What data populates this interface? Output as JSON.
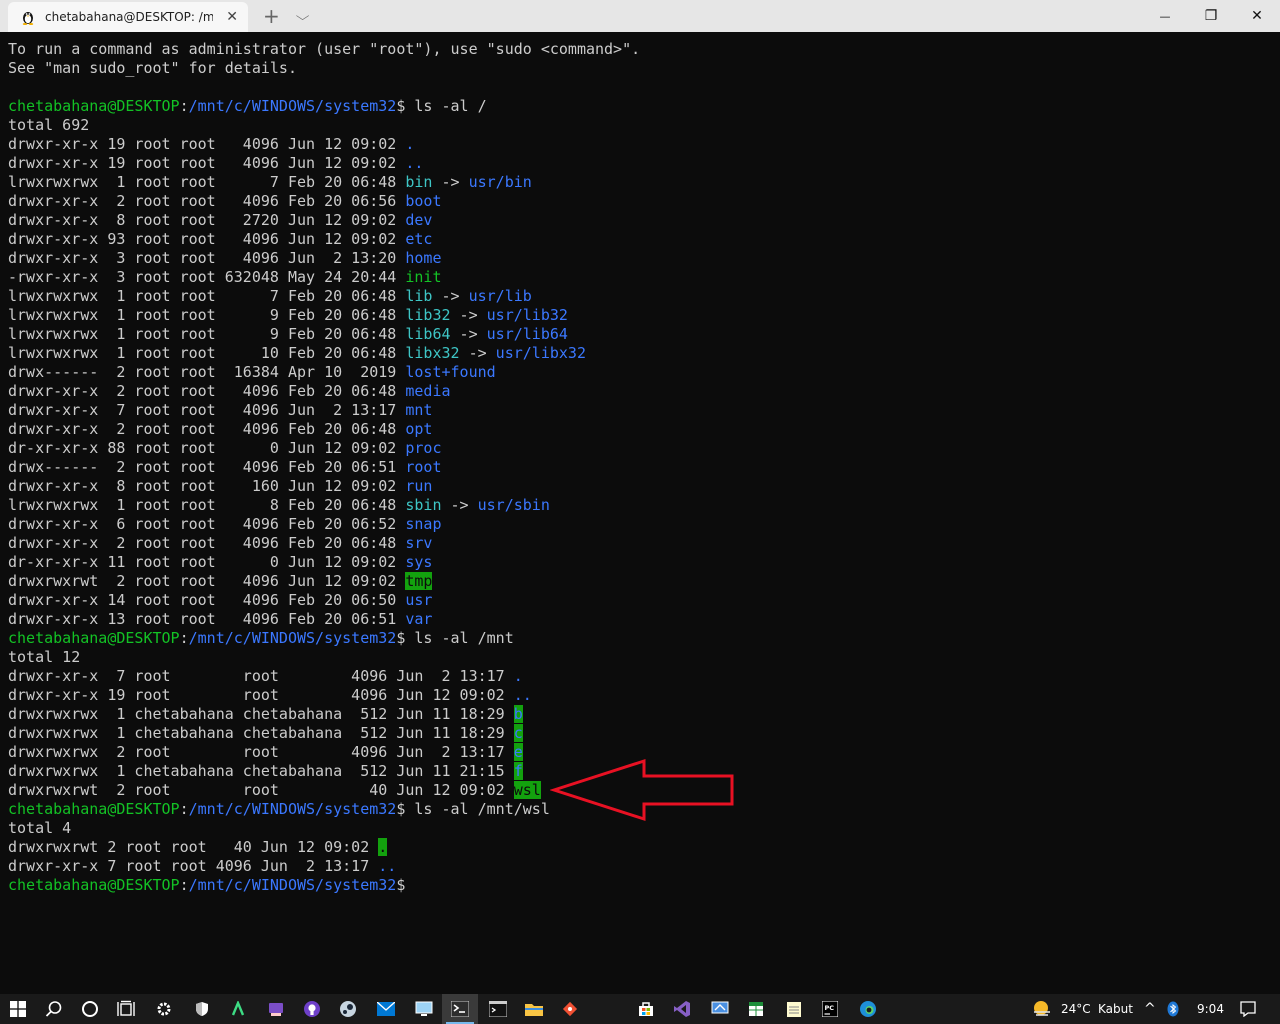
{
  "window": {
    "tab_title": "chetabahana@DESKTOP: /mnt/c",
    "tab_close": "✕",
    "new_tab": "+",
    "tab_dropdown": "⌵",
    "minimize": "—",
    "restore": "❐",
    "close": "✕"
  },
  "terminal": {
    "prompt_user": "chetabahana@DESKTOP",
    "prompt_path": "/mnt/c/WINDOWS/system32",
    "intro": [
      "To run a command as administrator (user \"root\"), use \"sudo <command>\".",
      "See \"man sudo_root\" for details."
    ],
    "commands": [
      {
        "cmd": "ls -al /",
        "total": "total 692",
        "rows": [
          {
            "meta": "drwxr-xr-x 19 root root   4096 Jun 12 09:02 ",
            "name": ".",
            "type": "dir"
          },
          {
            "meta": "drwxr-xr-x 19 root root   4096 Jun 12 09:02 ",
            "name": "..",
            "type": "dir"
          },
          {
            "meta": "lrwxrwxrwx  1 root root      7 Feb 20 06:48 ",
            "name": "bin",
            "type": "link",
            "target": "usr/bin"
          },
          {
            "meta": "drwxr-xr-x  2 root root   4096 Feb 20 06:56 ",
            "name": "boot",
            "type": "dir"
          },
          {
            "meta": "drwxr-xr-x  8 root root   2720 Jun 12 09:02 ",
            "name": "dev",
            "type": "dir"
          },
          {
            "meta": "drwxr-xr-x 93 root root   4096 Jun 12 09:02 ",
            "name": "etc",
            "type": "dir"
          },
          {
            "meta": "drwxr-xr-x  3 root root   4096 Jun  2 13:20 ",
            "name": "home",
            "type": "dir"
          },
          {
            "meta": "-rwxr-xr-x  3 root root 632048 May 24 20:44 ",
            "name": "init",
            "type": "exec"
          },
          {
            "meta": "lrwxrwxrwx  1 root root      7 Feb 20 06:48 ",
            "name": "lib",
            "type": "link",
            "target": "usr/lib"
          },
          {
            "meta": "lrwxrwxrwx  1 root root      9 Feb 20 06:48 ",
            "name": "lib32",
            "type": "link",
            "target": "usr/lib32"
          },
          {
            "meta": "lrwxrwxrwx  1 root root      9 Feb 20 06:48 ",
            "name": "lib64",
            "type": "link",
            "target": "usr/lib64"
          },
          {
            "meta": "lrwxrwxrwx  1 root root     10 Feb 20 06:48 ",
            "name": "libx32",
            "type": "link",
            "target": "usr/libx32"
          },
          {
            "meta": "drwx------  2 root root  16384 Apr 10  2019 ",
            "name": "lost+found",
            "type": "dir"
          },
          {
            "meta": "drwxr-xr-x  2 root root   4096 Feb 20 06:48 ",
            "name": "media",
            "type": "dir"
          },
          {
            "meta": "drwxr-xr-x  7 root root   4096 Jun  2 13:17 ",
            "name": "mnt",
            "type": "dir"
          },
          {
            "meta": "drwxr-xr-x  2 root root   4096 Feb 20 06:48 ",
            "name": "opt",
            "type": "dir"
          },
          {
            "meta": "dr-xr-xr-x 88 root root      0 Jun 12 09:02 ",
            "name": "proc",
            "type": "dir"
          },
          {
            "meta": "drwx------  2 root root   4096 Feb 20 06:51 ",
            "name": "root",
            "type": "dir"
          },
          {
            "meta": "drwxr-xr-x  8 root root    160 Jun 12 09:02 ",
            "name": "run",
            "type": "dir"
          },
          {
            "meta": "lrwxrwxrwx  1 root root      8 Feb 20 06:48 ",
            "name": "sbin",
            "type": "link",
            "target": "usr/sbin"
          },
          {
            "meta": "drwxr-xr-x  6 root root   4096 Feb 20 06:52 ",
            "name": "snap",
            "type": "dir"
          },
          {
            "meta": "drwxr-xr-x  2 root root   4096 Feb 20 06:48 ",
            "name": "srv",
            "type": "dir"
          },
          {
            "meta": "dr-xr-xr-x 11 root root      0 Jun 12 09:02 ",
            "name": "sys",
            "type": "dir"
          },
          {
            "meta": "drwxrwxrwt  2 root root   4096 Jun 12 09:02 ",
            "name": "tmp",
            "type": "sticky"
          },
          {
            "meta": "drwxr-xr-x 14 root root   4096 Feb 20 06:50 ",
            "name": "usr",
            "type": "dir"
          },
          {
            "meta": "drwxr-xr-x 13 root root   4096 Feb 20 06:51 ",
            "name": "var",
            "type": "dir"
          }
        ]
      },
      {
        "cmd": "ls -al /mnt",
        "total": "total 12",
        "rows": [
          {
            "meta": "drwxr-xr-x  7 root        root        4096 Jun  2 13:17 ",
            "name": ".",
            "type": "dir"
          },
          {
            "meta": "drwxr-xr-x 19 root        root        4096 Jun 12 09:02 ",
            "name": "..",
            "type": "dir"
          },
          {
            "meta": "drwxrwxrwx  1 chetabahana chetabahana  512 Jun 11 18:29 ",
            "name": "b",
            "type": "other"
          },
          {
            "meta": "drwxrwxrwx  1 chetabahana chetabahana  512 Jun 11 18:29 ",
            "name": "c",
            "type": "other"
          },
          {
            "meta": "drwxrwxrwx  2 root        root        4096 Jun  2 13:17 ",
            "name": "e",
            "type": "other"
          },
          {
            "meta": "drwxrwxrwx  1 chetabahana chetabahana  512 Jun 11 21:15 ",
            "name": "f",
            "type": "other"
          },
          {
            "meta": "drwxrwxrwt  2 root        root          40 Jun 12 09:02 ",
            "name": "wsl",
            "type": "sticky"
          }
        ]
      },
      {
        "cmd": "ls -al /mnt/wsl",
        "total": "total 4",
        "rows": [
          {
            "meta": "drwxrwxrwt 2 root root   40 Jun 12 09:02 ",
            "name": ".",
            "type": "sticky-dot"
          },
          {
            "meta": "drwxr-xr-x 7 root root 4096 Jun  2 13:17 ",
            "name": "..",
            "type": "dir"
          }
        ]
      }
    ]
  },
  "colors": {
    "background": "#0c0c0c",
    "text": "#cccccc",
    "prompt_green": "#13c225",
    "dir_blue": "#3b78ff",
    "link_cyan": "#3ec6c6",
    "highlight_green": "#13a10e",
    "arrow_red": "#e81123"
  },
  "taskbar": {
    "icons": [
      "windows-start-icon",
      "search-icon",
      "cortana-icon",
      "task-view-icon",
      "settings-icon",
      "shield-icon",
      "android-studio-icon",
      "github-desktop-icon",
      "github-icon",
      "steam-icon",
      "mail-icon",
      "remote-desktop-icon",
      "windows-terminal-icon",
      "command-prompt-icon",
      "file-explorer-icon",
      "git-icon",
      "store-icon",
      "visual-studio-icon",
      "connect-icon",
      "spreadsheet-icon",
      "notepad-icon",
      "pycharm-icon",
      "edge-icon"
    ],
    "weather_temp": "24°C",
    "weather_desc": "Kabut",
    "tray_chevron": "^",
    "time": "9:04"
  }
}
